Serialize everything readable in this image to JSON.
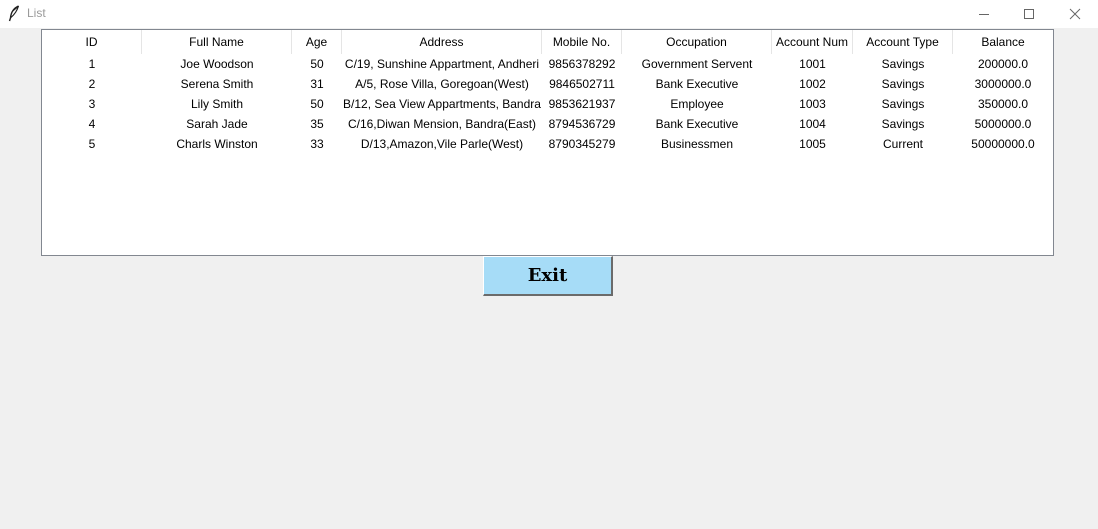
{
  "window": {
    "title": "List",
    "icon": "feather-icon"
  },
  "table": {
    "columns": [
      "ID",
      "Full Name",
      "Age",
      "Address",
      "Mobile No.",
      "Occupation",
      "Account Num",
      "Account Type",
      "Balance"
    ],
    "rows": [
      [
        "1",
        "Joe Woodson",
        "50",
        "C/19, Sunshine Appartment, Andheri",
        "9856378292",
        "Government Servent",
        "1001",
        "Savings",
        "200000.0"
      ],
      [
        "2",
        "Serena Smith",
        "31",
        "A/5, Rose Villa, Goregoan(West)",
        "9846502711",
        "Bank Executive",
        "1002",
        "Savings",
        "3000000.0"
      ],
      [
        "3",
        "Lily Smith",
        "50",
        "B/12, Sea View Appartments, Bandra",
        "9853621937",
        "Employee",
        "1003",
        "Savings",
        "350000.0"
      ],
      [
        "4",
        "Sarah Jade",
        "35",
        "C/16,Diwan Mension, Bandra(East)",
        "8794536729",
        "Bank Executive",
        "1004",
        "Savings",
        "5000000.0"
      ],
      [
        "5",
        "Charls Winston",
        "33",
        "D/13,Amazon,Vile Parle(West)",
        "8790345279",
        "Businessmen",
        "1005",
        "Current",
        "50000000.0"
      ]
    ]
  },
  "exit_button": {
    "label": "Exit",
    "color": "#a6dcf7"
  }
}
